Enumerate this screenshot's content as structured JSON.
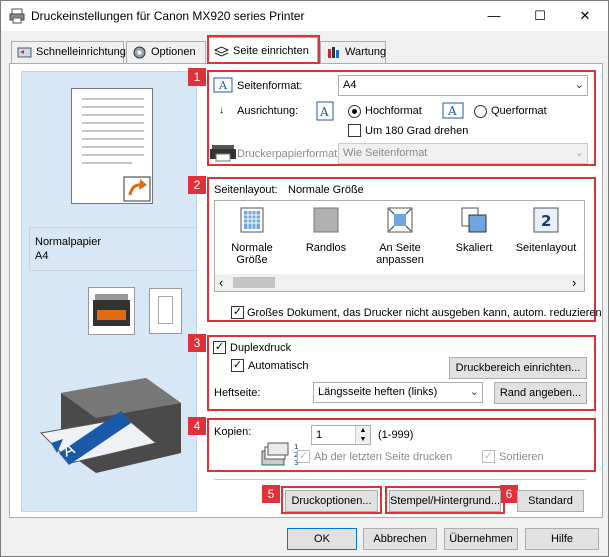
{
  "window": {
    "title": "Druckeinstellungen für Canon MX920 series Printer",
    "minimize": "—",
    "maximize": "☐",
    "close": "✕"
  },
  "tabs": [
    {
      "label": "Schnelleinrichtung",
      "icon": "quick-setup-icon"
    },
    {
      "label": "Optionen",
      "icon": "options-icon"
    },
    {
      "label": "Seite einrichten",
      "icon": "page-setup-icon",
      "active": true
    },
    {
      "label": "Wartung",
      "icon": "maintenance-icon"
    }
  ],
  "preview": {
    "media_type": "Normalpapier",
    "paper_size": "A4"
  },
  "badges": [
    "1",
    "2",
    "3",
    "4",
    "5",
    "6"
  ],
  "page_setup": {
    "page_size_label": "Seitenformat:",
    "page_size_value": "A4",
    "orientation_label": "Ausrichtung:",
    "portrait_label": "Hochformat",
    "landscape_label": "Querformat",
    "orientation_selected": "Hochformat",
    "rotate_label": "Um 180 Grad drehen",
    "rotate_checked": false,
    "printer_paper_label": "Druckerpapierformat:",
    "printer_paper_value": "Wie Seitenformat"
  },
  "page_layout": {
    "label": "Seitenlayout:",
    "value": "Normale Größe",
    "items": [
      {
        "label": "Normale Größe",
        "icon": "normal-size-icon",
        "selected": true
      },
      {
        "label": "Randlos",
        "icon": "borderless-icon"
      },
      {
        "label": "An Seite anpassen",
        "icon": "fit-to-page-icon"
      },
      {
        "label": "Skaliert",
        "icon": "scaled-icon"
      },
      {
        "label": "Seitenlayout",
        "icon": "page-layout-icon"
      }
    ],
    "scroll_left": "‹",
    "scroll_right": "›",
    "large_doc_label": "Großes Dokument, das Drucker nicht ausgeben kann, autom. reduzieren",
    "large_doc_checked": true
  },
  "duplex": {
    "label": "Duplexdruck",
    "checked": true,
    "auto_label": "Automatisch",
    "auto_checked": true,
    "print_area_button": "Druckbereich einrichten...",
    "stapling_label": "Heftseite:",
    "stapling_value": "Längsseite heften (links)",
    "margin_button": "Rand angeben..."
  },
  "copies": {
    "label": "Kopien:",
    "value": "1",
    "range": "(1-999)",
    "last_page_first_label": "Ab der letzten Seite drucken",
    "collate_label": "Sortieren"
  },
  "bottom_buttons": {
    "print_options": "Druckoptionen...",
    "stamp_background": "Stempel/Hintergrund...",
    "defaults": "Standard"
  },
  "dialog_buttons": {
    "ok": "OK",
    "cancel": "Abbrechen",
    "apply": "Übernehmen",
    "help": "Hilfe"
  },
  "colors": {
    "accent_red": "#e0303a",
    "preview_bg": "#d7e7f5",
    "dialog_bg": "#f0f0f0"
  }
}
